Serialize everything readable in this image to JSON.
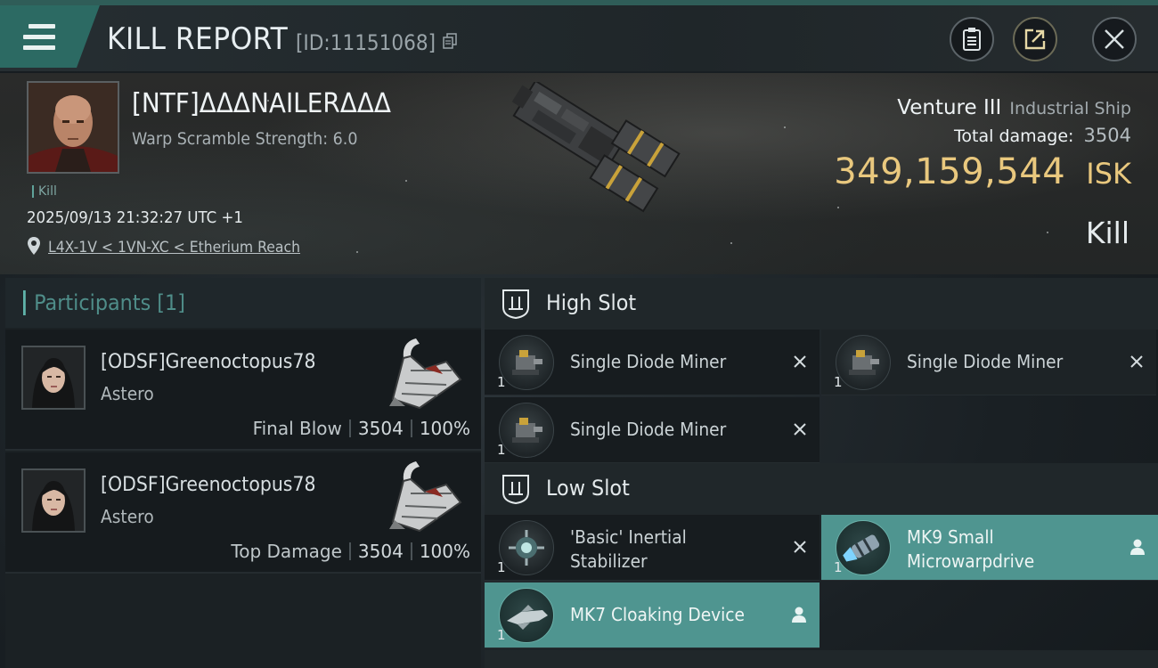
{
  "header": {
    "title": "KILL REPORT",
    "report_id": "[ID:11151068]",
    "icons": [
      "menu-icon",
      "copy-icon",
      "clipboard-icon",
      "share-icon",
      "close-icon"
    ]
  },
  "victim": {
    "name": "[NTF]ΔΔΔNAILERΔΔΔ",
    "warp_scramble": "Warp Scramble Strength: 6.0",
    "tag": "Kill",
    "datetime": "2025/09/13 21:32:27 UTC +1",
    "location": "L4X-1V < 1VN-XC < Etherium Reach",
    "ship_name": "Venture III",
    "ship_class": "Industrial Ship",
    "total_damage_label": "Total damage:",
    "total_damage": "3504",
    "isk_value": "349,159,544",
    "isk_unit": "ISK",
    "result": "Kill"
  },
  "participants": {
    "title": "Participants [1]",
    "rows": [
      {
        "name": "[ODSF]Greenoctopus78",
        "ship": "Astero",
        "role": "Final Blow",
        "damage": "3504",
        "percent": "100%"
      },
      {
        "name": "[ODSF]Greenoctopus78",
        "ship": "Astero",
        "role": "Top Damage",
        "damage": "3504",
        "percent": "100%"
      }
    ]
  },
  "fitting": {
    "high_slot": {
      "title": "High Slot",
      "modules": [
        {
          "name": "Single Diode Miner",
          "qty": "1",
          "status": "destroyed"
        },
        {
          "name": "Single Diode Miner",
          "qty": "1",
          "status": "destroyed"
        },
        {
          "name": "Single Diode Miner",
          "qty": "1",
          "status": "destroyed"
        }
      ]
    },
    "low_slot": {
      "title": "Low Slot",
      "modules": [
        {
          "name": "'Basic' Inertial Stabilizer",
          "qty": "1",
          "status": "destroyed"
        },
        {
          "name": "MK9 Small Microwarpdrive",
          "qty": "1",
          "status": "dropped"
        },
        {
          "name": "MK7 Cloaking Device",
          "qty": "1",
          "status": "dropped"
        }
      ]
    }
  },
  "colors": {
    "accent_teal": "#2c6a63",
    "dropped_teal": "#4f9590",
    "isk_gold": "#e9c87e"
  }
}
